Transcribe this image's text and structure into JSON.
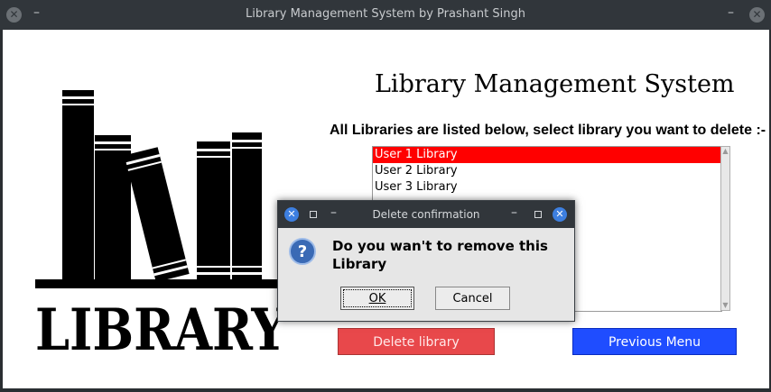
{
  "window": {
    "title": "Library Management System by Prashant Singh"
  },
  "logo": {
    "text": "LIBRARY"
  },
  "main": {
    "app_title": "Library Management System",
    "prompt": "All Libraries are listed below, select library you want to delete :-",
    "libraries": [
      "User 1 Library",
      "User 2 Library",
      "User 3 Library"
    ],
    "selected_index": 0,
    "delete_label": "Delete library",
    "prev_label": "Previous Menu"
  },
  "dialog": {
    "title": "Delete confirmation",
    "message": "Do you wan't to remove this Library",
    "ok_label": "OK",
    "cancel_label": "Cancel"
  },
  "colors": {
    "selection": "#ff0000",
    "delete_button": "#e8484b",
    "prev_button": "#1f4dff"
  }
}
